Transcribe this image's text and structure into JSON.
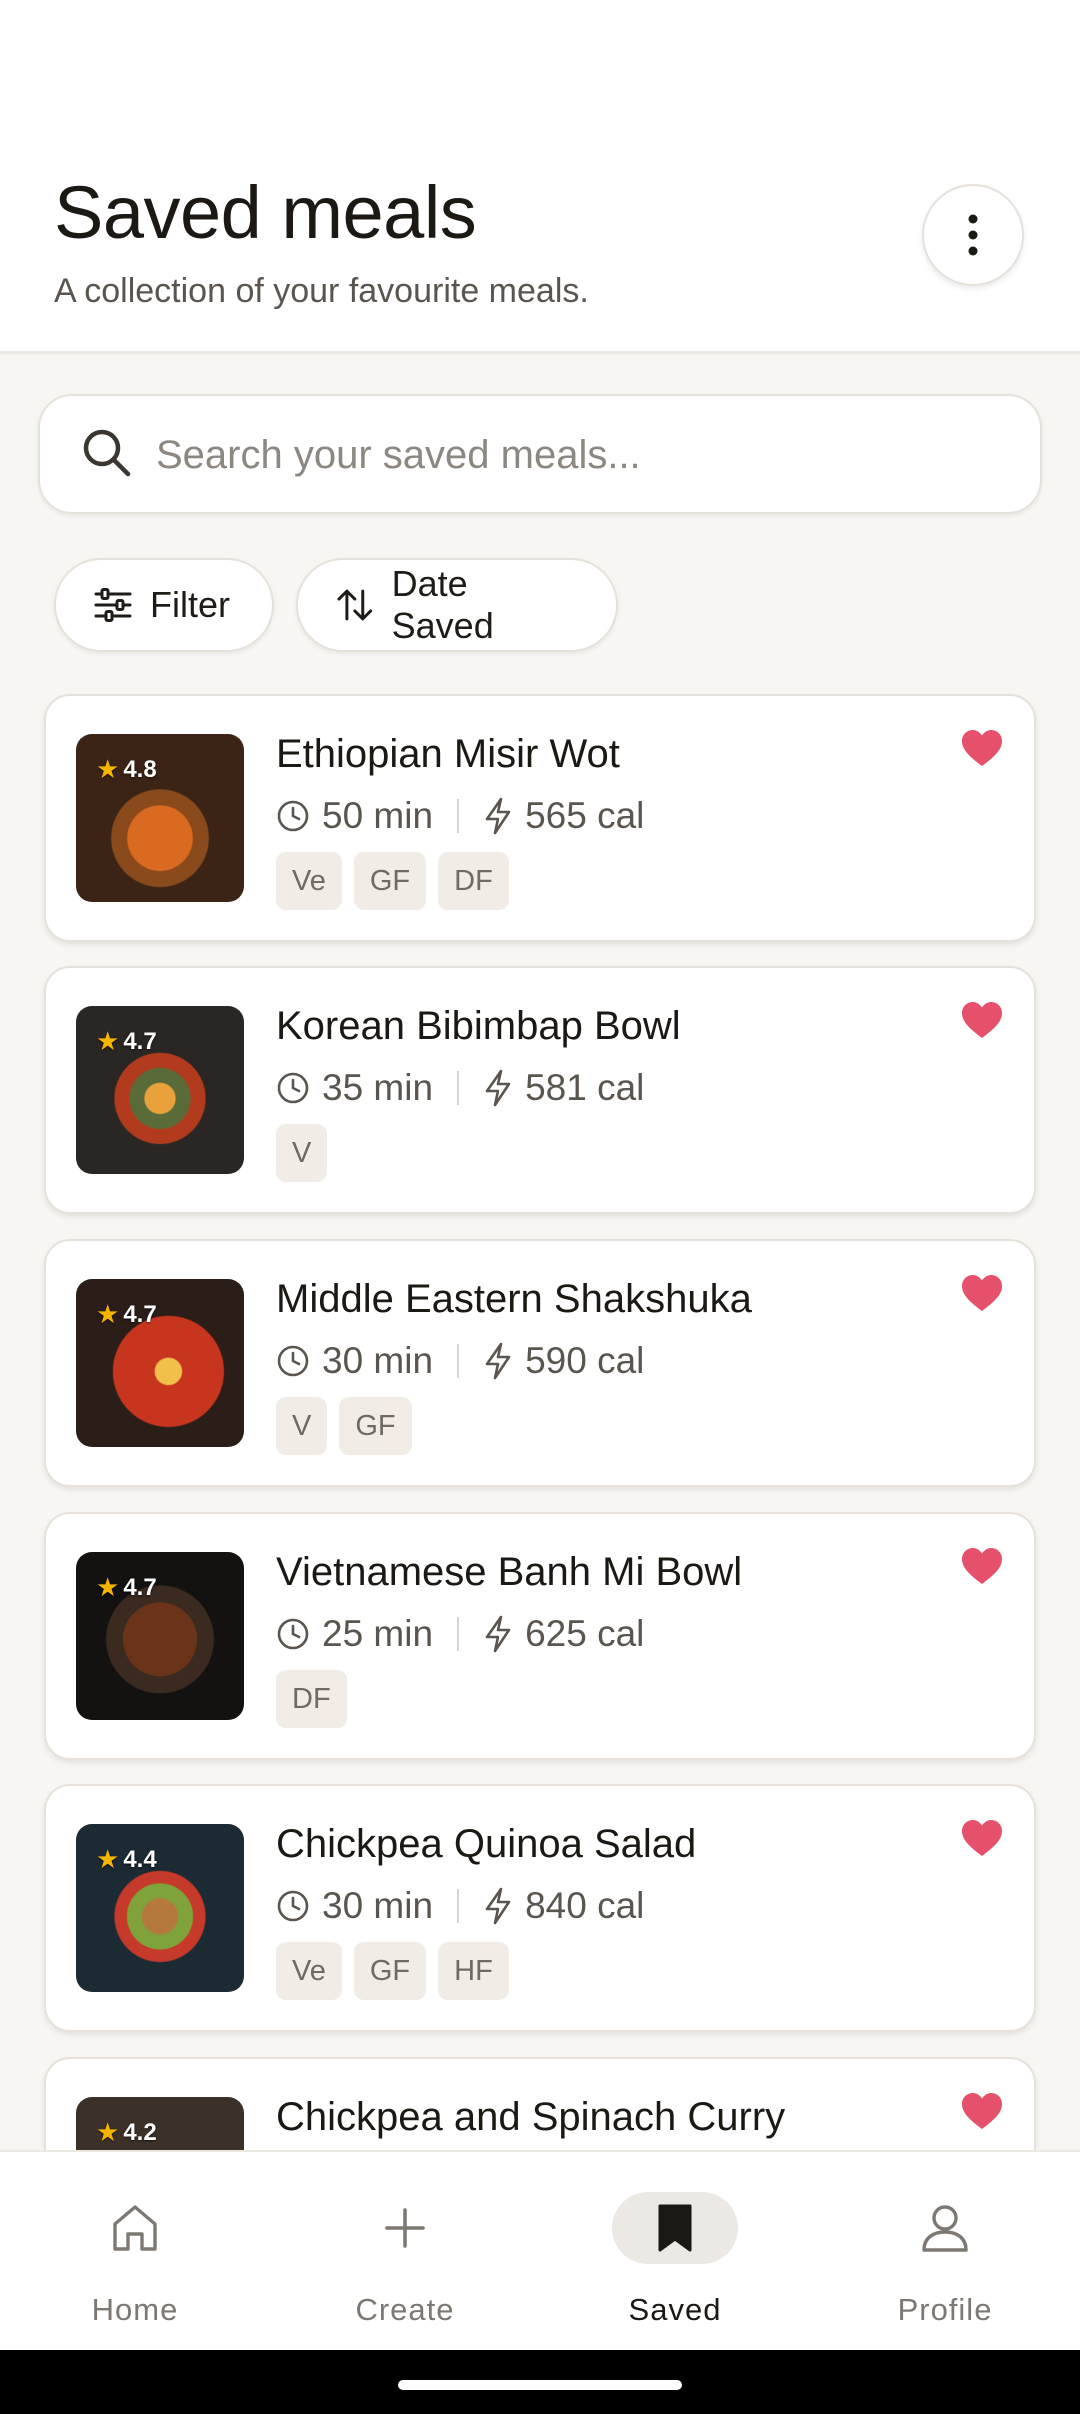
{
  "header": {
    "title": "Saved meals",
    "subtitle": "A collection of your favourite meals.",
    "more_icon": "more-vertical-icon"
  },
  "search": {
    "placeholder": "Search your saved meals...",
    "value": ""
  },
  "controls": {
    "filter_label": "Filter",
    "sort_label": "Date Saved"
  },
  "meals": [
    {
      "title": "Ethiopian Misir Wot",
      "time": "50 min",
      "calories": "565 cal",
      "rating": "4.8",
      "tags": [
        "Ve",
        "GF",
        "DF"
      ],
      "favorited": true
    },
    {
      "title": "Korean Bibimbap Bowl",
      "time": "35 min",
      "calories": "581 cal",
      "rating": "4.7",
      "tags": [
        "V"
      ],
      "favorited": true
    },
    {
      "title": "Middle Eastern Shakshuka",
      "time": "30 min",
      "calories": "590 cal",
      "rating": "4.7",
      "tags": [
        "V",
        "GF"
      ],
      "favorited": true
    },
    {
      "title": "Vietnamese Banh Mi Bowl",
      "time": "25 min",
      "calories": "625 cal",
      "rating": "4.7",
      "tags": [
        "DF"
      ],
      "favorited": true
    },
    {
      "title": "Chickpea Quinoa Salad",
      "time": "30 min",
      "calories": "840 cal",
      "rating": "4.4",
      "tags": [
        "Ve",
        "GF",
        "HF"
      ],
      "favorited": true
    },
    {
      "title": "Chickpea and Spinach Curry",
      "time": "",
      "calories": "",
      "rating": "4.2",
      "tags": [],
      "favorited": true
    }
  ],
  "nav": [
    {
      "label": "Home",
      "icon": "home-icon",
      "active": false
    },
    {
      "label": "Create",
      "icon": "plus-icon",
      "active": false
    },
    {
      "label": "Saved",
      "icon": "bookmark-icon",
      "active": true
    },
    {
      "label": "Profile",
      "icon": "person-icon",
      "active": false
    }
  ],
  "colors": {
    "accent_heart": "#e5506a",
    "star": "#f4b400",
    "background": "#f8f6f3",
    "card": "#ffffff"
  }
}
